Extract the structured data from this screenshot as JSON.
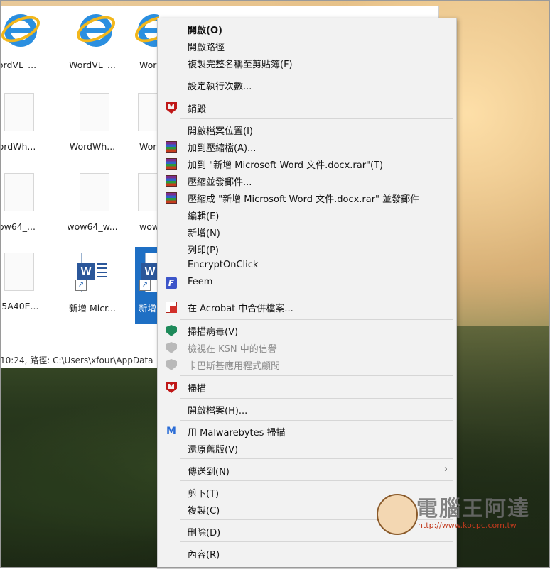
{
  "explorer": {
    "files": [
      {
        "label": "ordVL_...",
        "type": "ie"
      },
      {
        "label": "WordVL_...",
        "type": "ie"
      },
      {
        "label": "Wor",
        "type": "ie"
      },
      {
        "label": "ordWh...",
        "type": "blank"
      },
      {
        "label": "WordWh...",
        "type": "blank"
      },
      {
        "label": "Wor",
        "type": "blank"
      },
      {
        "label": "ow64_...",
        "type": "blank"
      },
      {
        "label": "wow64_w...",
        "type": "blank"
      },
      {
        "label": "wow",
        "type": "blank"
      },
      {
        "label": "C5A40E...",
        "type": "blank"
      },
      {
        "label": "新增 Micr...",
        "type": "word"
      },
      {
        "label": "新增",
        "type": "word",
        "selected": true
      }
    ],
    "status_text": "10:24, 路徑: C:\\Users\\xfour\\AppData"
  },
  "menu": {
    "items": [
      {
        "label": "開啟(O)",
        "bold": true
      },
      {
        "label": "開啟路徑"
      },
      {
        "label": "複製完整名稱至剪貼簿(F)"
      },
      {
        "label": "設定執行次數..."
      },
      {
        "label": "銷毀",
        "icon": "mcafee-icon"
      },
      {
        "label": "開啟檔案位置(I)"
      },
      {
        "label": "加到壓縮檔(A)...",
        "icon": "winrar-icon"
      },
      {
        "label": "加到 \"新增 Microsoft Word 文件.docx.rar\"(T)",
        "icon": "winrar-icon"
      },
      {
        "label": "壓縮並發郵件...",
        "icon": "winrar-icon"
      },
      {
        "label": "壓縮成 \"新增 Microsoft Word 文件.docx.rar\" 並發郵件",
        "icon": "winrar-icon"
      },
      {
        "label": "編輯(E)"
      },
      {
        "label": "新增(N)"
      },
      {
        "label": "列印(P)"
      },
      {
        "label": "EncryptOnClick"
      },
      {
        "label": "Feem",
        "icon": "feem-icon"
      },
      {
        "label": "在 Acrobat 中合併檔案...",
        "icon": "acrobat-icon"
      },
      {
        "label": "掃描病毒(V)",
        "icon": "kaspersky-icon"
      },
      {
        "label": "檢視在 KSN 中的信譽",
        "icon": "kaspersky-grey-icon",
        "disabled": true
      },
      {
        "label": "卡巴斯基應用程式顧問",
        "icon": "kaspersky-grey-icon",
        "disabled": true
      },
      {
        "label": "掃描",
        "icon": "mcafee-icon"
      },
      {
        "label": "開啟檔案(H)..."
      },
      {
        "label": "用 Malwarebytes 掃描",
        "icon": "malwarebytes-icon"
      },
      {
        "label": "還原舊版(V)"
      },
      {
        "label": "傳送到(N)",
        "submenu": true
      },
      {
        "label": "剪下(T)"
      },
      {
        "label": "複製(C)"
      },
      {
        "label": "刪除(D)"
      },
      {
        "label": "內容(R)"
      }
    ],
    "submenu_arrow": "›"
  },
  "watermark": {
    "name": "電腦王阿達",
    "url": "http://www.kocpc.com.tw"
  },
  "colors": {
    "menu_bg": "#f2f2f2",
    "selection": "#1e6fc4",
    "word_blue": "#2b579a"
  }
}
